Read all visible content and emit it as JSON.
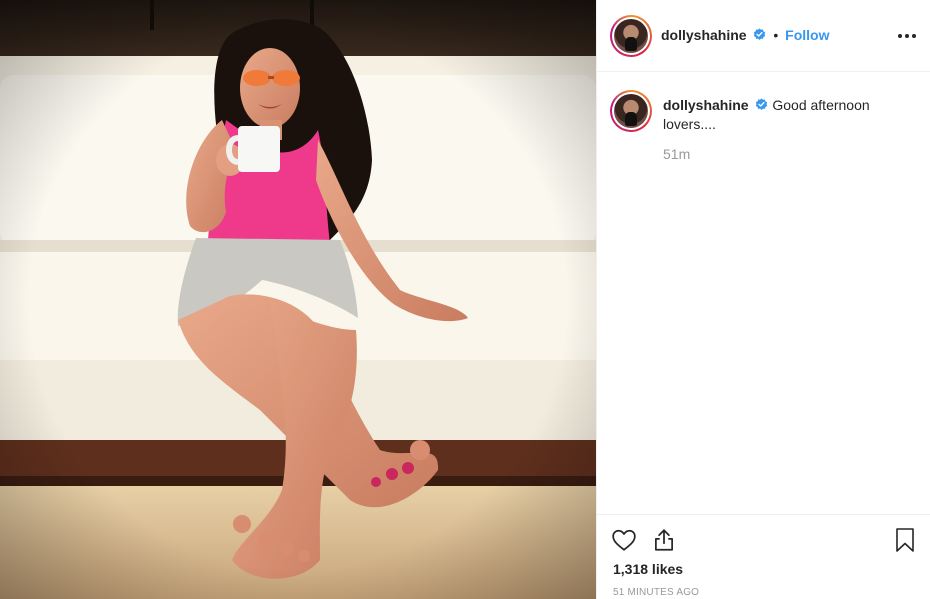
{
  "post": {
    "author": "dollyshahine",
    "follow_label": "Follow",
    "separator": "•",
    "verified_icon": "verified-badge-icon",
    "more_icon": "more-options-icon",
    "photo_description_icon": "post-photo"
  },
  "comment": {
    "author": "dollyshahine",
    "text": "Good afternoon lovers....",
    "time": "51m"
  },
  "actions": {
    "like_icon": "heart-icon",
    "share_icon": "share-icon",
    "save_icon": "bookmark-icon"
  },
  "stats": {
    "likes": "1,318 likes",
    "posted_ago": "51 MINUTES AGO"
  },
  "colors": {
    "link": "#3897f0",
    "muted": "#999999",
    "text": "#262626",
    "verified": "#3897f0"
  }
}
